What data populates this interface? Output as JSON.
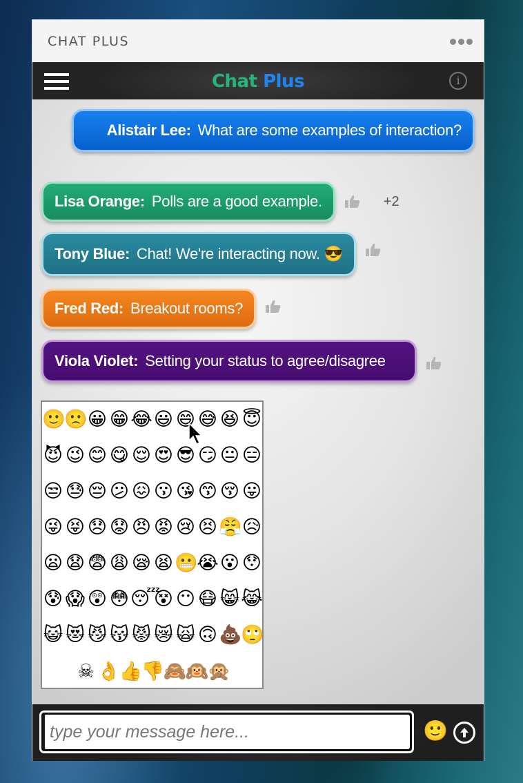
{
  "window": {
    "title": "CHAT PLUS",
    "more_icon": "ellipsis-icon"
  },
  "appbar": {
    "brand_part1": "Chat",
    "brand_part2": "Plus",
    "brand_color1": "#27b47b",
    "brand_color2": "#1e86f0",
    "menu_icon": "hamburger-icon",
    "info_icon": "info-icon",
    "info_glyph": "i"
  },
  "messages": [
    {
      "sender": "Alistair Lee:",
      "text": "What are some examples of interaction?",
      "color": "#0a6fe0",
      "border": "#8ec4ff",
      "align": "right"
    },
    {
      "sender": "Lisa Orange:",
      "text": "Polls are a good example.",
      "color": "#1e9c6b",
      "border": "#9fe3c6",
      "likes": "+2"
    },
    {
      "sender": "Tony Blue:",
      "text": "Chat! We're interacting now. 😎",
      "color": "#247f95",
      "border": "#a7dbe7"
    },
    {
      "sender": "Fred Red:",
      "text": "Breakout rooms?",
      "color": "#ee7a14",
      "border": "#ffcc9a"
    },
    {
      "sender": "Viola Violet:",
      "text": "Setting your status to agree/disagree",
      "color": "#4c0f78",
      "border": "#c29ad8"
    }
  ],
  "emoji_picker": {
    "emojis": [
      "🙂",
      "🙁",
      "😀",
      "😁",
      "😂",
      "😃",
      "😄",
      "😅",
      "😆",
      "😇",
      "😈",
      "😉",
      "😊",
      "😋",
      "😌",
      "😍",
      "😎",
      "😏",
      "😐",
      "😑",
      "😒",
      "😓",
      "😔",
      "😕",
      "😖",
      "😗",
      "😘",
      "😙",
      "😚",
      "😛",
      "😜",
      "😝",
      "😞",
      "😟",
      "😠",
      "😡",
      "😢",
      "😣",
      "😤",
      "😥",
      "😦",
      "😧",
      "😨",
      "😩",
      "😪",
      "😫",
      "😬",
      "😭",
      "😮",
      "😯",
      "😰",
      "😱",
      "😲",
      "😳",
      "😴",
      "😵",
      "😶",
      "😷",
      "😸",
      "😹",
      "😺",
      "😻",
      "😼",
      "😽",
      "😾",
      "😿",
      "🙀",
      "🙃",
      "💩",
      "🙄"
    ],
    "last_row": [
      "☠",
      "👌",
      "👍",
      "👎",
      "🙈",
      "🙉",
      "🙊"
    ]
  },
  "composer": {
    "placeholder": "type your message here...",
    "value": "",
    "emoji_button": "🙂",
    "send_icon": "send-arrow-icon"
  }
}
